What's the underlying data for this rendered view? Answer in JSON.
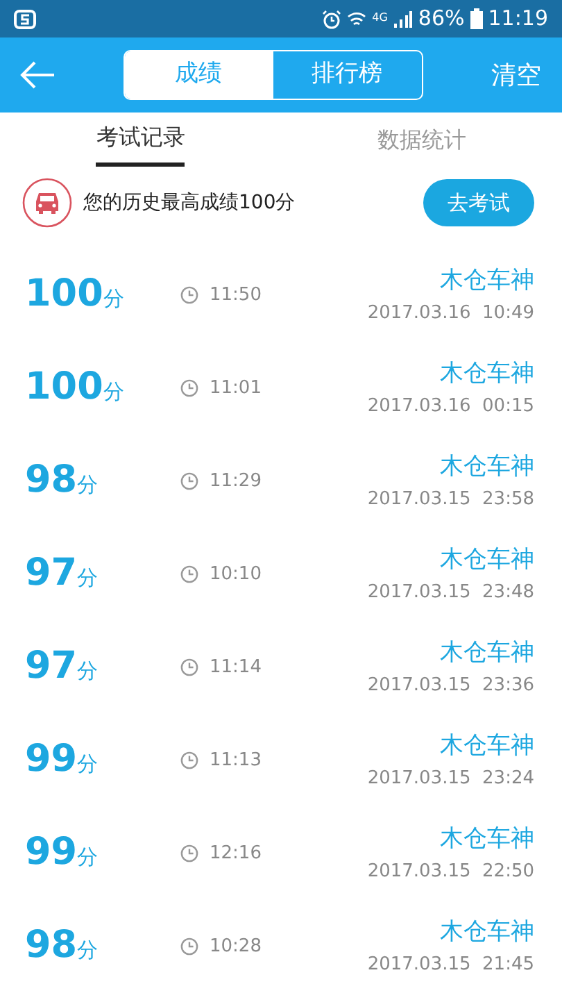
{
  "status_bar": {
    "network": "4G",
    "battery": "86%",
    "time": "11:19"
  },
  "app_bar": {
    "segments": [
      {
        "label": "成绩",
        "selected": true
      },
      {
        "label": "排行榜",
        "selected": false
      }
    ],
    "action": "清空"
  },
  "tabs": [
    {
      "label": "考试记录",
      "selected": true
    },
    {
      "label": "数据统计",
      "selected": false
    }
  ],
  "best": {
    "text": "您的历史最高成绩100分",
    "button": "去考试"
  },
  "records": [
    {
      "score": "100",
      "unit": "分",
      "duration": "11:50",
      "name": "木仓车神",
      "date": "2017.03.16  10:49"
    },
    {
      "score": "100",
      "unit": "分",
      "duration": "11:01",
      "name": "木仓车神",
      "date": "2017.03.16  00:15"
    },
    {
      "score": "98",
      "unit": "分",
      "duration": "11:29",
      "name": "木仓车神",
      "date": "2017.03.15  23:58"
    },
    {
      "score": "97",
      "unit": "分",
      "duration": "10:10",
      "name": "木仓车神",
      "date": "2017.03.15  23:48"
    },
    {
      "score": "97",
      "unit": "分",
      "duration": "11:14",
      "name": "木仓车神",
      "date": "2017.03.15  23:36"
    },
    {
      "score": "99",
      "unit": "分",
      "duration": "11:13",
      "name": "木仓车神",
      "date": "2017.03.15  23:24"
    },
    {
      "score": "99",
      "unit": "分",
      "duration": "12:16",
      "name": "木仓车神",
      "date": "2017.03.15  22:50"
    },
    {
      "score": "98",
      "unit": "分",
      "duration": "10:28",
      "name": "木仓车神",
      "date": "2017.03.15  21:45"
    }
  ]
}
